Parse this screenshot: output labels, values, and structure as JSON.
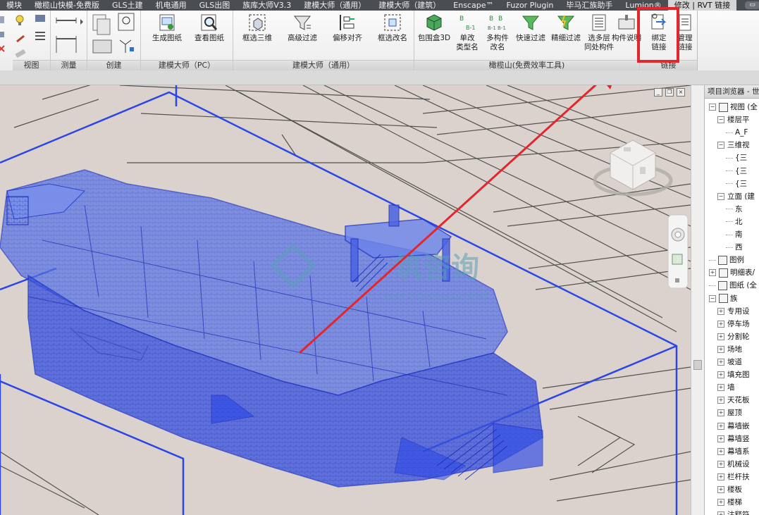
{
  "ribbon_tabs": [
    {
      "label": "模块",
      "active": false
    },
    {
      "label": "橄榄山快模-免费版",
      "active": false
    },
    {
      "label": "GLS土建",
      "active": false
    },
    {
      "label": "机电通用",
      "active": false
    },
    {
      "label": "GLS出图",
      "active": false
    },
    {
      "label": "族库大师V3.3",
      "active": false
    },
    {
      "label": "建模大师（通用）",
      "active": false
    },
    {
      "label": "建模大师（建筑）",
      "active": false
    },
    {
      "label": "Enscape™",
      "active": false
    },
    {
      "label": "Fuzor Plugin",
      "active": false
    },
    {
      "label": "毕马汇族助手",
      "active": false
    },
    {
      "label": "Lumion®",
      "active": false
    },
    {
      "label": "修改 | RVT 链接",
      "active": true
    }
  ],
  "panels": {
    "view": "视图",
    "measure": "测量",
    "create": "创建",
    "jmds_pc": "建模大师（PC）",
    "jmds_general": "建模大师（通用）",
    "gls": "橄榄山(免费效率工具)",
    "link": "链接"
  },
  "buttons": {
    "generate_sheet": "生成图纸",
    "view_sheet": "查看图纸",
    "box_select_3d": [
      "框选三维"
    ],
    "advanced_filter": [
      "高级过滤"
    ],
    "offset_align": [
      "偏移对齐"
    ],
    "box_rename": [
      "框选改名"
    ],
    "bbox_3d": [
      "包围盒3D"
    ],
    "single_rename": [
      "单改",
      "类型名"
    ],
    "multi_rename": [
      "多构件",
      "改名"
    ],
    "quick_filter": [
      "快速过滤"
    ],
    "fine_filter": [
      "精细过滤"
    ],
    "multi_level": [
      "选多层",
      "同处构件"
    ],
    "component_desc": [
      "构件说明"
    ],
    "bind_link": [
      "绑定",
      "链接"
    ],
    "manage_link": [
      "管理",
      "链接"
    ]
  },
  "watermark": {
    "cn": "筑咨询",
    "en": "ZHU CONSULTATION"
  },
  "browser": {
    "title": "项目浏览器 - 世",
    "items": [
      {
        "label": "视图 (全",
        "toggle": "−",
        "level": 0,
        "icon": true
      },
      {
        "label": "楼层平",
        "toggle": "−",
        "level": 1,
        "icon": false
      },
      {
        "label": "A_F",
        "toggle": "",
        "level": 2,
        "icon": false
      },
      {
        "label": "三维视",
        "toggle": "−",
        "level": 1,
        "icon": false
      },
      {
        "label": "{三",
        "toggle": "",
        "level": 2,
        "icon": false
      },
      {
        "label": "{三",
        "toggle": "",
        "level": 2,
        "icon": false
      },
      {
        "label": "{三",
        "toggle": "",
        "level": 2,
        "icon": false
      },
      {
        "label": "立面 (建",
        "toggle": "−",
        "level": 1,
        "icon": false
      },
      {
        "label": "东",
        "toggle": "",
        "level": 2,
        "icon": false
      },
      {
        "label": "北",
        "toggle": "",
        "level": 2,
        "icon": false
      },
      {
        "label": "南",
        "toggle": "",
        "level": 2,
        "icon": false
      },
      {
        "label": "西",
        "toggle": "",
        "level": 2,
        "icon": false
      },
      {
        "label": "图例",
        "toggle": "",
        "level": 0,
        "icon": true
      },
      {
        "label": "明细表/",
        "toggle": "+",
        "level": 0,
        "icon": true
      },
      {
        "label": "图纸 (全",
        "toggle": "",
        "level": 0,
        "icon": true
      },
      {
        "label": "族",
        "toggle": "−",
        "level": 0,
        "icon": true
      },
      {
        "label": "专用设",
        "toggle": "+",
        "level": 1,
        "icon": false
      },
      {
        "label": "停车场",
        "toggle": "+",
        "level": 1,
        "icon": false
      },
      {
        "label": "分割轮",
        "toggle": "+",
        "level": 1,
        "icon": false
      },
      {
        "label": "场地",
        "toggle": "+",
        "level": 1,
        "icon": false
      },
      {
        "label": "坡道",
        "toggle": "+",
        "level": 1,
        "icon": false
      },
      {
        "label": "填充图",
        "toggle": "+",
        "level": 1,
        "icon": false
      },
      {
        "label": "墙",
        "toggle": "+",
        "level": 1,
        "icon": false
      },
      {
        "label": "天花板",
        "toggle": "+",
        "level": 1,
        "icon": false
      },
      {
        "label": "屋顶",
        "toggle": "+",
        "level": 1,
        "icon": false
      },
      {
        "label": "幕墙嵌",
        "toggle": "+",
        "level": 1,
        "icon": false
      },
      {
        "label": "幕墙竖",
        "toggle": "+",
        "level": 1,
        "icon": false
      },
      {
        "label": "幕墙系",
        "toggle": "+",
        "level": 1,
        "icon": false
      },
      {
        "label": "机械设",
        "toggle": "+",
        "level": 1,
        "icon": false
      },
      {
        "label": "栏杆扶",
        "toggle": "+",
        "level": 1,
        "icon": false
      },
      {
        "label": "楼板",
        "toggle": "+",
        "level": 1,
        "icon": false
      },
      {
        "label": "楼梯",
        "toggle": "+",
        "level": 1,
        "icon": false
      },
      {
        "label": "注释符",
        "toggle": "+",
        "level": 1,
        "icon": false
      }
    ]
  },
  "colors": {
    "accent_red": "#e3262d",
    "model_blue": "#2a46e8",
    "tab_bg": "#4a4d52",
    "viewport_bg": "#dcd2cd",
    "watermark": "#5aa0b8"
  },
  "icons": {
    "tab_pill": "▭",
    "view_min": "_",
    "view_restore": "❐",
    "view_close": "×"
  }
}
